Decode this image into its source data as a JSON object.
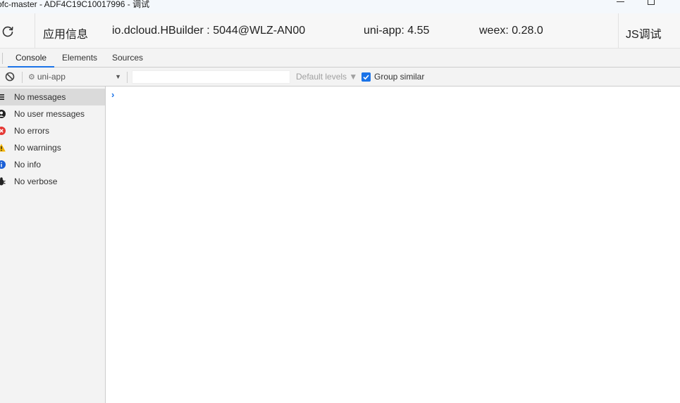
{
  "window": {
    "title": "ofc-master - ADF4C19C10017996 - 调试"
  },
  "infobar": {
    "app_info": "应用信息",
    "package": "io.dcloud.HBuilder : 5044@WLZ-AN00",
    "uniapp_version": "uni-app: 4.55",
    "weex_version": "weex: 0.28.0",
    "js_debug": "JS调试"
  },
  "tabs": [
    {
      "label": "Console",
      "active": true
    },
    {
      "label": "Elements",
      "active": false
    },
    {
      "label": "Sources",
      "active": false
    }
  ],
  "toolbar": {
    "context": "uni-app",
    "filter_placeholder": "",
    "levels": "Default levels ▼",
    "group_similar": "Group similar",
    "group_similar_checked": true
  },
  "sidebar": {
    "items": [
      {
        "label": "No messages",
        "icon": "list-icon",
        "selected": true
      },
      {
        "label": "No user messages",
        "icon": "user-icon",
        "selected": false
      },
      {
        "label": "No errors",
        "icon": "error-icon",
        "selected": false
      },
      {
        "label": "No warnings",
        "icon": "warning-icon",
        "selected": false
      },
      {
        "label": "No info",
        "icon": "info-icon",
        "selected": false
      },
      {
        "label": "No verbose",
        "icon": "bug-icon",
        "selected": false
      }
    ]
  },
  "console": {
    "prompt": "›"
  },
  "colors": {
    "accent": "#1a73e8",
    "error": "#e53935",
    "warning": "#f4b400",
    "info": "#1a73e8"
  }
}
